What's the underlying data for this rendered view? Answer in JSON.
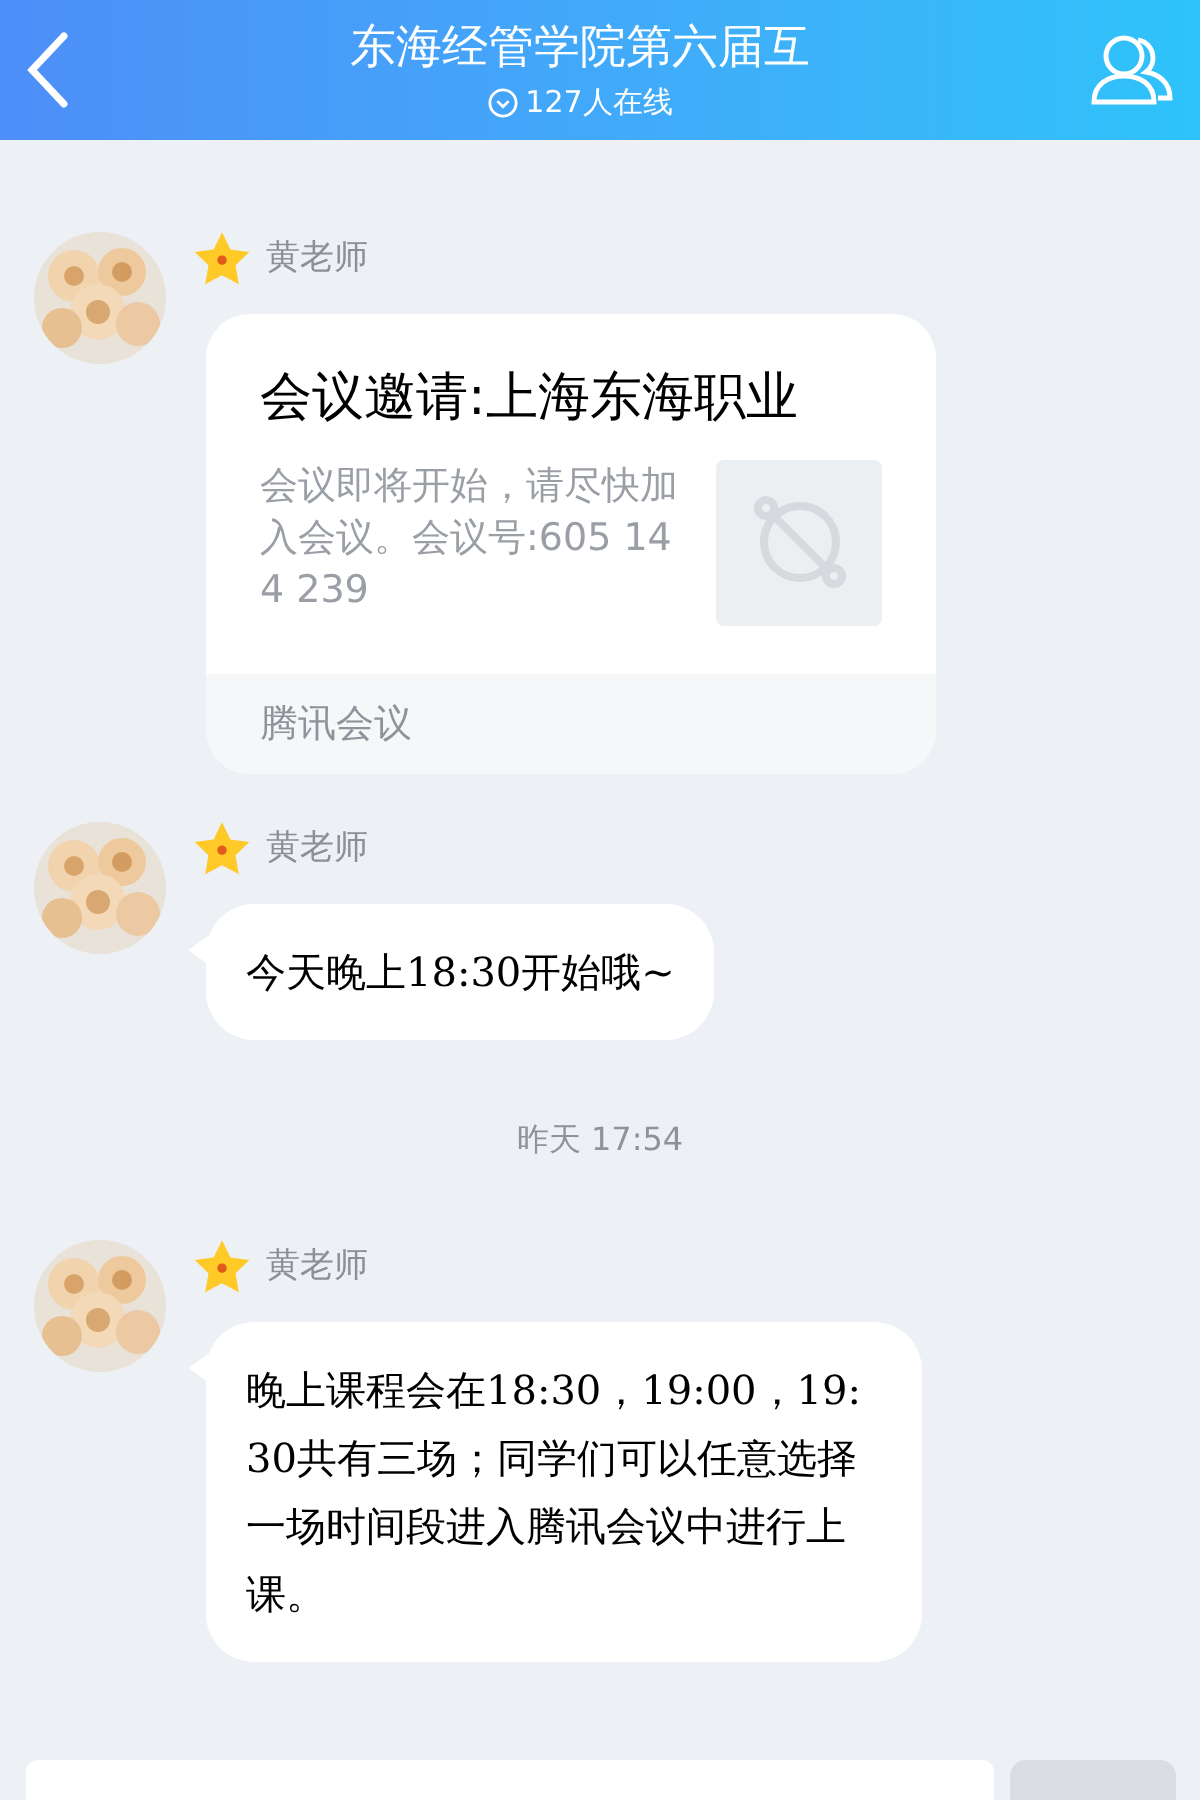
{
  "header": {
    "title": "东海经管学院第六届互",
    "online": "127人在线"
  },
  "messages": [
    {
      "kind": "card",
      "sender": "黄老师",
      "title": "会议邀请:上海东海职业",
      "body": "会议即将开始，请尽快加入会议。会议号:605 144 239",
      "source": "腾讯会议"
    },
    {
      "kind": "text",
      "sender": "黄老师",
      "text": "今天晚上18:30开始哦~"
    },
    {
      "kind": "time",
      "text": "昨天 17:54"
    },
    {
      "kind": "text",
      "sender": "黄老师",
      "text": "晚上课程会在18:30，19:00，19:30共有三场；同学们可以任意选择一场时间段进入腾讯会议中进行上课。"
    }
  ]
}
